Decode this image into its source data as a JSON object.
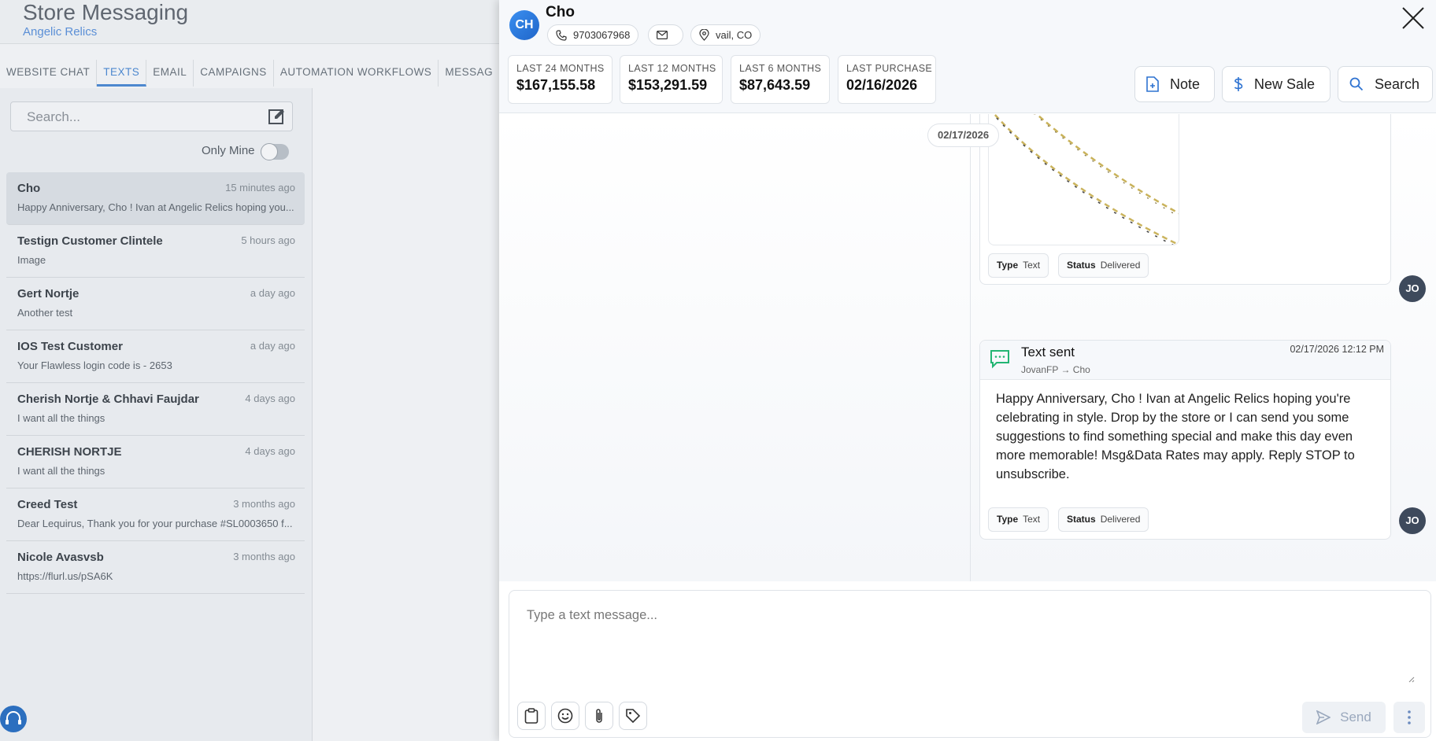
{
  "background": {
    "title": "Store Messaging",
    "subtitle": "Angelic Relics",
    "tabs": [
      "WEBSITE CHAT",
      "TEXTS",
      "EMAIL",
      "CAMPAIGNS",
      "AUTOMATION WORKFLOWS",
      "MESSAG"
    ],
    "active_tab": "TEXTS",
    "search_placeholder": "Search...",
    "only_mine_label": "Only Mine",
    "conversations": [
      {
        "name": "Cho",
        "time": "15 minutes ago",
        "preview": "Happy Anniversary, Cho ! Ivan at Angelic Relics hoping you..."
      },
      {
        "name": "Testign Customer Clintele",
        "time": "5 hours ago",
        "preview": "Image"
      },
      {
        "name": "Gert Nortje",
        "time": "a day ago",
        "preview": "Another test"
      },
      {
        "name": "IOS Test Customer",
        "time": "a day ago",
        "preview": "Your Flawless login code is - 2653"
      },
      {
        "name": "Cherish Nortje & Chhavi Faujdar",
        "time": "4 days ago",
        "preview": "I want all the things"
      },
      {
        "name": "CHERISH NORTJE",
        "time": "4 days ago",
        "preview": "I want all the things"
      },
      {
        "name": "Creed Test",
        "time": "3 months ago",
        "preview": "Dear Lequirus, Thank you for your purchase #SL0003650 f..."
      },
      {
        "name": "Nicole Avasvsb",
        "time": "3 months ago",
        "preview": "https://flurl.us/pSA6K"
      }
    ]
  },
  "contact": {
    "initials": "CH",
    "name": "Cho",
    "phone": "9703067968",
    "location": "vail, CO"
  },
  "stats": [
    {
      "label": "LAST 24 MONTHS",
      "value": "$167,155.58"
    },
    {
      "label": "LAST 12 MONTHS",
      "value": "$153,291.59"
    },
    {
      "label": "LAST 6 MONTHS",
      "value": "$87,643.59"
    },
    {
      "label": "LAST PURCHASE",
      "value": "02/16/2026"
    }
  ],
  "actions": {
    "note": "Note",
    "new_sale": "New Sale",
    "search": "Search"
  },
  "thread": {
    "date_pill": "02/17/2026",
    "image_message": {
      "type_label": "Type",
      "type_value": "Text",
      "status_label": "Status",
      "status_value": "Delivered",
      "sender_initials": "JO"
    },
    "text_message": {
      "title": "Text sent",
      "route": "JovanFP → Cho",
      "timestamp": "02/17/2026 12:12 PM",
      "body": "Happy Anniversary, Cho ! Ivan at Angelic Relics hoping you're celebrating in style. Drop by the store or I can send you some suggestions to find something special and make this day even more memorable! Msg&Data Rates may apply. Reply STOP to unsubscribe.",
      "type_label": "Type",
      "type_value": "Text",
      "status_label": "Status",
      "status_value": "Delivered",
      "sender_initials": "JO"
    }
  },
  "composer": {
    "placeholder": "Type a text message...",
    "send_label": "Send"
  },
  "colors": {
    "accent": "#1f65c9",
    "text_icon": "#22b573"
  }
}
